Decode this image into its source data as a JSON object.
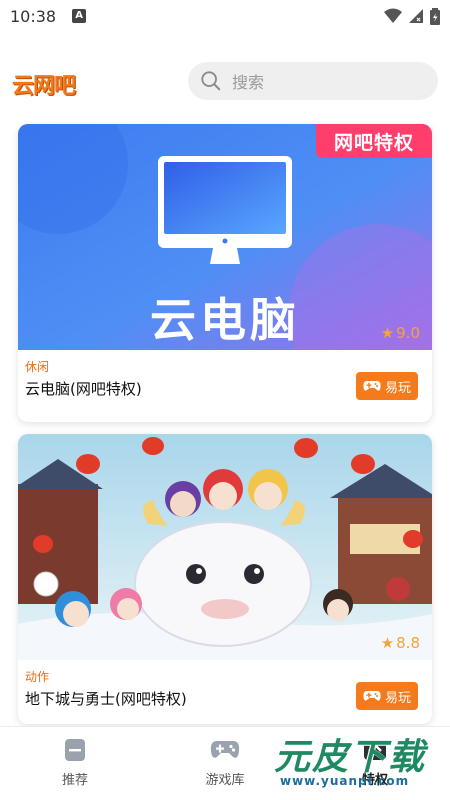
{
  "status_bar": {
    "time": "10:38",
    "notification_glyph": "A"
  },
  "header": {
    "logo_text": "云网吧",
    "search_placeholder": "搜索"
  },
  "games": [
    {
      "badge": "网吧特权",
      "image_text": "云电脑",
      "rating": "9.0",
      "category": "休闲",
      "title": "云电脑(网吧特权)",
      "play_label": "易玩"
    },
    {
      "rating": "8.8",
      "category": "动作",
      "title": "地下城与勇士(网吧特权)",
      "play_label": "易玩"
    }
  ],
  "bottom_nav": {
    "items": [
      {
        "label": "推荐",
        "icon": "recommend-icon"
      },
      {
        "label": "游戏库",
        "icon": "gamepad-icon"
      },
      {
        "label": "特权",
        "icon": "privilege-icon",
        "active": true
      }
    ]
  },
  "watermark": {
    "text": "元皮下载",
    "url": "www.yuanpi.com"
  },
  "colors": {
    "accent": "#f57a1c",
    "badge": "#ff3e6c",
    "rating": "#f7a23b"
  }
}
